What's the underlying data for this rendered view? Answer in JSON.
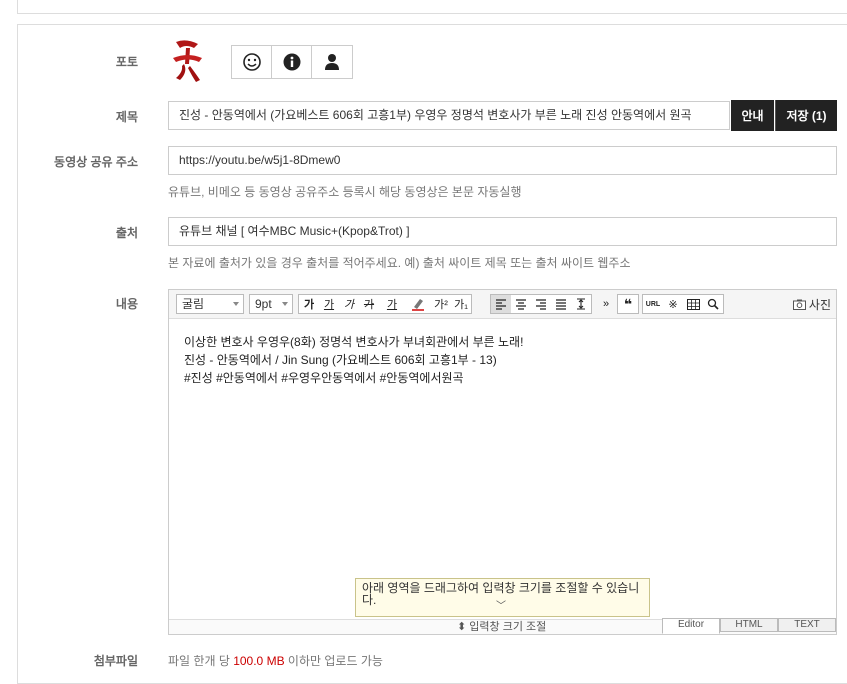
{
  "form": {
    "photo_label": "포토",
    "title_label": "제목",
    "title_value": "진성 - 안동역에서 (가요베스트 606회 고흥1부) 우영우 정명석 변호사가 부른 노래 진성 안동역에서 원곡",
    "guide_button": "안내",
    "save_button": "저장 (1)",
    "video_label": "동영상 공유 주소",
    "video_value": "https://youtu.be/w5j1-8Dmew0",
    "video_hint": "유튜브, 비메오 등 동영상 공유주소 등록시 해당 동영상은 본문 자동실행",
    "source_label": "출처",
    "source_value": "유튜브 채널 [ 여수MBC Music+(Kpop&Trot) ]",
    "source_hint": "본 자료에 출처가 있을 경우 출처를 적어주세요. 예) 출처 싸이트 제목 또는 출처 싸이트 웹주소",
    "content_label": "내용",
    "attach_label": "첨부파일",
    "attach_hint_pre": "파일 한개 당 ",
    "attach_hint_size": "100.0 MB",
    "attach_hint_post": " 이하만 업로드 가능"
  },
  "editor": {
    "font_family": "굴림",
    "font_size": "9pt",
    "photo_button": "사진",
    "lines": [
      "이상한 변호사 우영우(8화) 정명석 변호사가 부녀회관에서 부른 노래!",
      "진성 - 안동역에서 / Jin Sung (가요베스트 606회 고흥1부 - 13)",
      "#진성 #안동역에서 #우영우안동역에서 #안동역에서원곡"
    ],
    "tooltip": "아래 영역을 드래그하여 입력창 크기를 조절할 수 있습니다.",
    "resize_label": "입력창 크기 조절",
    "tabs": [
      "Editor",
      "HTML",
      "TEXT"
    ],
    "toolbar_buttons": {
      "bold": "가",
      "underline": "가",
      "italic": "가",
      "strike": "가",
      "fontcolor": "가",
      "superscript": "가²",
      "subscript": "가₁",
      "url": "URL",
      "more": "»",
      "special": "※"
    }
  },
  "colors": {
    "accent_red": "#cc0000",
    "dark_button": "#222222"
  }
}
